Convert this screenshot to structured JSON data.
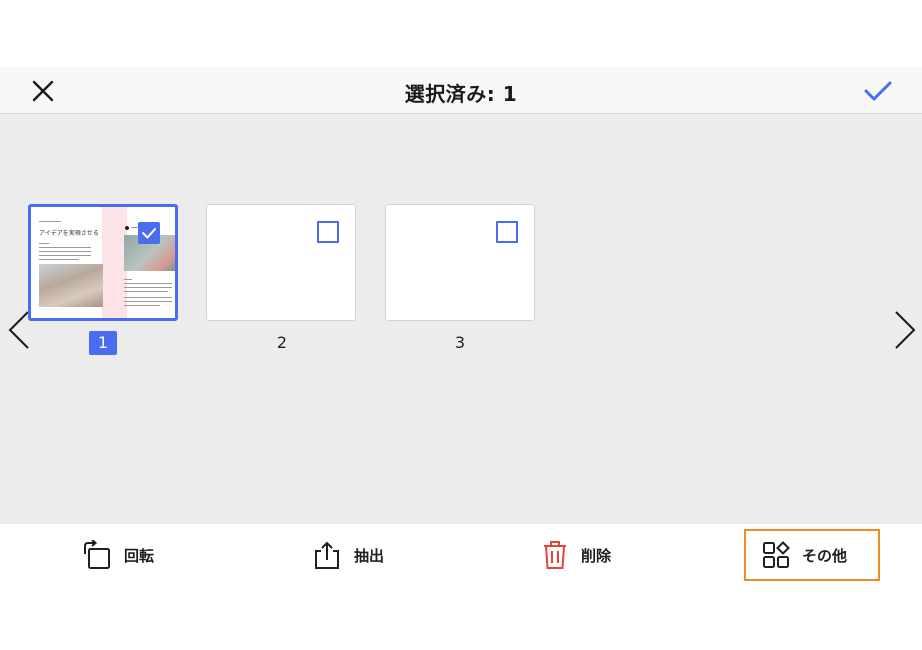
{
  "header": {
    "title": "選択済み: 1",
    "close_icon": "close-icon",
    "confirm_icon": "checkmark-icon"
  },
  "colors": {
    "accent": "#4a6cf0",
    "delete": "#e5453a",
    "highlight_border": "#f08a24",
    "content_background": "#ececec"
  },
  "pages": [
    {
      "number": "1",
      "selected": true,
      "preview_subtitle": "アイデアを実現させる"
    },
    {
      "number": "2",
      "selected": false
    },
    {
      "number": "3",
      "selected": false
    }
  ],
  "navigation": {
    "prev_icon": "chevron-left-icon",
    "next_icon": "chevron-right-icon"
  },
  "toolbar": {
    "rotate": {
      "label": "回転",
      "icon": "rotate-icon"
    },
    "extract": {
      "label": "抽出",
      "icon": "extract-icon"
    },
    "delete": {
      "label": "削除",
      "icon": "trash-icon"
    },
    "more": {
      "label": "その他",
      "icon": "grid-shapes-icon",
      "highlighted": true
    }
  }
}
